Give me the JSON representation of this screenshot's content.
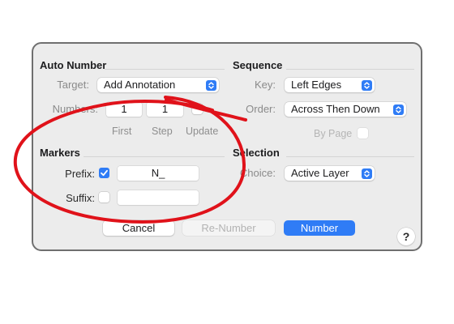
{
  "auto_number": {
    "title": "Auto Number",
    "target_label": "Target:",
    "target_value": "Add Annotation",
    "numbers_label": "Numbers:",
    "first_value": "1",
    "step_value": "1",
    "first_caption": "First",
    "step_caption": "Step",
    "update_caption": "Update"
  },
  "sequence": {
    "title": "Sequence",
    "key_label": "Key:",
    "key_value": "Left Edges",
    "order_label": "Order:",
    "order_value": "Across Then Down",
    "by_page_label": "By Page"
  },
  "markers": {
    "title": "Markers",
    "prefix_label": "Prefix:",
    "prefix_checked": true,
    "prefix_value": "N_",
    "suffix_label": "Suffix:",
    "suffix_checked": false,
    "suffix_value": ""
  },
  "selection": {
    "title": "Selection",
    "choice_label": "Choice:",
    "choice_value": "Active Layer"
  },
  "buttons": {
    "cancel": "Cancel",
    "renumber": "Re-Number",
    "number": "Number",
    "help": "?"
  },
  "colors": {
    "accent": "#2f7cf6",
    "annotation_red": "#e0121a"
  }
}
